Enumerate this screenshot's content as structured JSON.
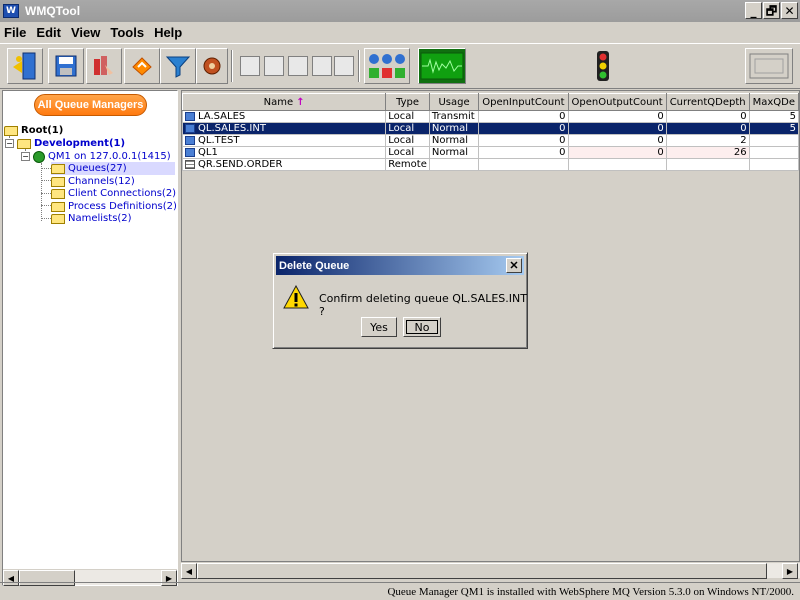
{
  "window": {
    "title": "WMQTool",
    "icon_label": "W",
    "buttons": {
      "minimize": "_",
      "restore": "🗗",
      "close": "✕"
    }
  },
  "menu": [
    "File",
    "Edit",
    "View",
    "Tools",
    "Help"
  ],
  "toolbar": {
    "icons": [
      "exit-icon",
      "save-icon",
      "queue-manager-icon",
      "refresh-icon",
      "filter-icon",
      "settings-icon",
      "view-list-icon",
      "view-details-icon",
      "view-chart-icon",
      "view-print-icon",
      "view-blank-icon",
      "status-lights-icon",
      "monitor-icon",
      "traffic-light-icon",
      "console-icon"
    ]
  },
  "tree": {
    "all_qm_button": "All Queue Managers",
    "root": "Root(1)",
    "development": "Development(1)",
    "qm": "QM1 on 127.0.0.1(1415)",
    "children": [
      "Queues(27)",
      "Channels(12)",
      "Client Connections(2)",
      "Process Definitions(2)",
      "Namelists(2)"
    ]
  },
  "table": {
    "columns": [
      "Name",
      "Type",
      "Usage",
      "OpenInputCount",
      "OpenOutputCount",
      "CurrentQDepth",
      "MaxQDe"
    ],
    "sort_indicator": "↑",
    "rows": [
      {
        "name": "LA.SALES",
        "type": "Local",
        "usage": "Transmit",
        "in": "0",
        "out": "0",
        "depth": "0",
        "max": "5"
      },
      {
        "name": "QL.SALES.INT",
        "type": "Local",
        "usage": "Normal",
        "in": "0",
        "out": "0",
        "depth": "0",
        "max": "5"
      },
      {
        "name": "QL.TEST",
        "type": "Local",
        "usage": "Normal",
        "in": "0",
        "out": "0",
        "depth": "2",
        "max": ""
      },
      {
        "name": "QL1",
        "type": "Local",
        "usage": "Normal",
        "in": "0",
        "out": "0",
        "depth": "26",
        "max": ""
      },
      {
        "name": "QR.SEND.ORDER",
        "type": "Remote",
        "usage": "",
        "in": "",
        "out": "",
        "depth": "",
        "max": ""
      }
    ]
  },
  "dialog": {
    "title": "Delete Queue",
    "close": "✕",
    "message": "Confirm deleting queue QL.SALES.INT ?",
    "yes": "Yes",
    "no": "No"
  },
  "status": {
    "text": "Queue Manager QM1 is installed with WebSphere MQ Version 5.3.0 on Windows NT/2000."
  },
  "scroll": {
    "left": "◀",
    "right": "▶"
  },
  "colors": {
    "selection": "#0a246a",
    "accent": "#ff7a10",
    "tree_link": "#0000cc"
  }
}
